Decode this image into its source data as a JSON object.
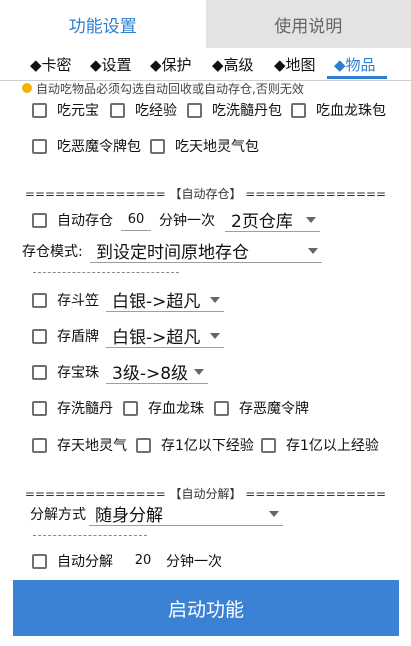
{
  "tabs": [
    {
      "label": "功能设置",
      "active": true
    },
    {
      "label": "使用说明",
      "active": false
    }
  ],
  "subtabs": [
    "◆卡密",
    "◆设置",
    "◆保护",
    "◆高级",
    "◆地图",
    "◆物品"
  ],
  "active_subtab": "◆物品",
  "notice": "自动吃物品必须勾选自动回收或自动存仓,否则无效",
  "eat_items": [
    "吃元宝",
    "吃经验",
    "吃洗髓丹包",
    "吃血龙珠包",
    "吃恶魔令牌包",
    "吃天地灵气包"
  ],
  "auto_store": {
    "header": "============== 【自动存仓】 ==============",
    "label": "自动存仓",
    "interval_value": "60",
    "interval_unit": "分钟一次",
    "page_select": "2页仓库",
    "mode_label": "存仓模式:",
    "mode_select": "到设定时间原地存仓",
    "divider": "------------------------------------------"
  },
  "store_items": {
    "doulì": {
      "label": "存斗笠",
      "select": "白银->超凡"
    },
    "dunpai": {
      "label": "存盾牌",
      "select": "白银->超凡"
    },
    "baozhu": {
      "label": "存宝珠",
      "select": "3级->8级"
    },
    "row4": [
      "存洗髓丹",
      "存血龙珠",
      "存恶魔令牌"
    ],
    "row5": [
      "存天地灵气",
      "存1亿以下经验",
      "存1亿以上经验"
    ]
  },
  "auto_decompose": {
    "header": "============== 【自动分解】 ==============",
    "method_label": "分解方式",
    "method_select": "随身分解",
    "divider": "------------------------------------------",
    "label": "自动分解",
    "interval_value": "20",
    "interval_unit": "分钟一次"
  },
  "start_button": "启动功能",
  "colors": {
    "accent": "#2d7fd2",
    "button": "#3c82d4",
    "tab_inactive": "#e3e3e3"
  }
}
